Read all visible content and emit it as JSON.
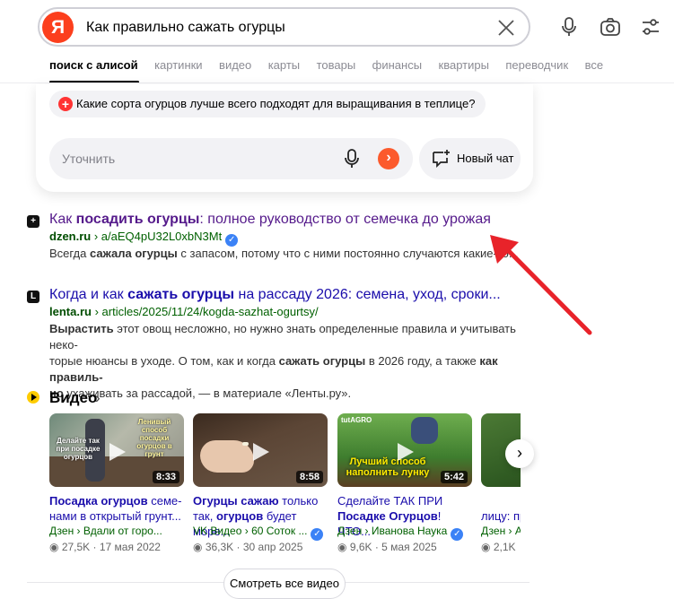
{
  "header": {
    "logo_letter": "Я",
    "query": "Как правильно сажать огурцы",
    "tabs": [
      "поиск с алисой",
      "картинки",
      "видео",
      "карты",
      "товары",
      "финансы",
      "квартиры",
      "переводчик",
      "все"
    ]
  },
  "alice": {
    "suggestion": "Какие сорта огурцов лучше всего подходят для выращивания в теплице?",
    "refine_placeholder": "Уточнить",
    "new_chat_label": "Новый чат"
  },
  "results": [
    {
      "favicon": "+",
      "title_pre": "Как ",
      "title_bold": "посадить огурцы",
      "title_post": ": полное руководство от семечка до урожая",
      "domain": "dzen.ru",
      "path": " › a/aEQ4pU32L0xbN3Mt",
      "snippet_pre": "Всегда ",
      "snippet_bold": "сажала огурцы",
      "snippet_post": " с запасом, потому что с ними постоянно случаются какие-то..."
    },
    {
      "favicon": "L",
      "title_pre": "Когда и как ",
      "title_bold": "сажать огурцы",
      "title_post": " на рассаду 2026: семена, уход, сроки...",
      "domain": "lenta.ru",
      "path": " › articles/2025/11/24/kogda-sazhat-ogurtsy/",
      "snippet_l1_bold": "Вырастить",
      "snippet_l1": " этот овощ несложно, но нужно знать определенные правила и учитывать неко-",
      "snippet_l2_pre": "торые нюансы в уходе. О том, как и когда ",
      "snippet_l2_bold1": "сажать огурцы",
      "snippet_l2_mid": " в 2026 году, а также ",
      "snippet_l2_bold2": "как правиль-",
      "snippet_l3_bold": "но",
      "snippet_l3": " ухаживать за рассадой, — в материале «Ленты.ру»."
    }
  ],
  "video": {
    "heading": "Видео",
    "cards": [
      {
        "duration": "8:33",
        "thumb_caption": "Делайте так при посадке огурцов",
        "thumb_caption2": "Ленивый способ посадки огурцов в грунт",
        "title_bold": "Посадка огурцов",
        "title_rest": " семе-",
        "title_l2": "нами в открытый грунт...",
        "source": "Дзен › Вдали от горо...",
        "views": "27,5K",
        "date": "17 мая 2022"
      },
      {
        "duration": "8:58",
        "title_bold": "Огурцы сажаю",
        "title_rest": " только",
        "title_l2_pre": "так, ",
        "title_l2_bold": "огурцов",
        "title_l2_post": " будет море...",
        "source": "VK Видео › 60 Соток ...",
        "views": "36,3K",
        "date": "30 апр 2025"
      },
      {
        "duration": "5:42",
        "thumb_caption": "Лучший способ наполнить лунку",
        "thumb_brand": "tutAGRO",
        "title_l1": "Сделайте ТАК ПРИ",
        "title_bold": "Посадке Огурцов",
        "title_rest": "! ЧТО...",
        "source": "Дзен › Иванова Наука",
        "views": "9,6K",
        "date": "5 мая 2025"
      },
      {
        "title_l1": "лицу: пр",
        "source": "Дзен › А",
        "views": "2,1K"
      }
    ],
    "all_button": "Смотреть все видео"
  },
  "colors": {
    "brand": "#fc3f1d",
    "link": "#1a0dab",
    "visited": "#551a8b",
    "url": "#006000",
    "arrow": "#e8232a"
  }
}
